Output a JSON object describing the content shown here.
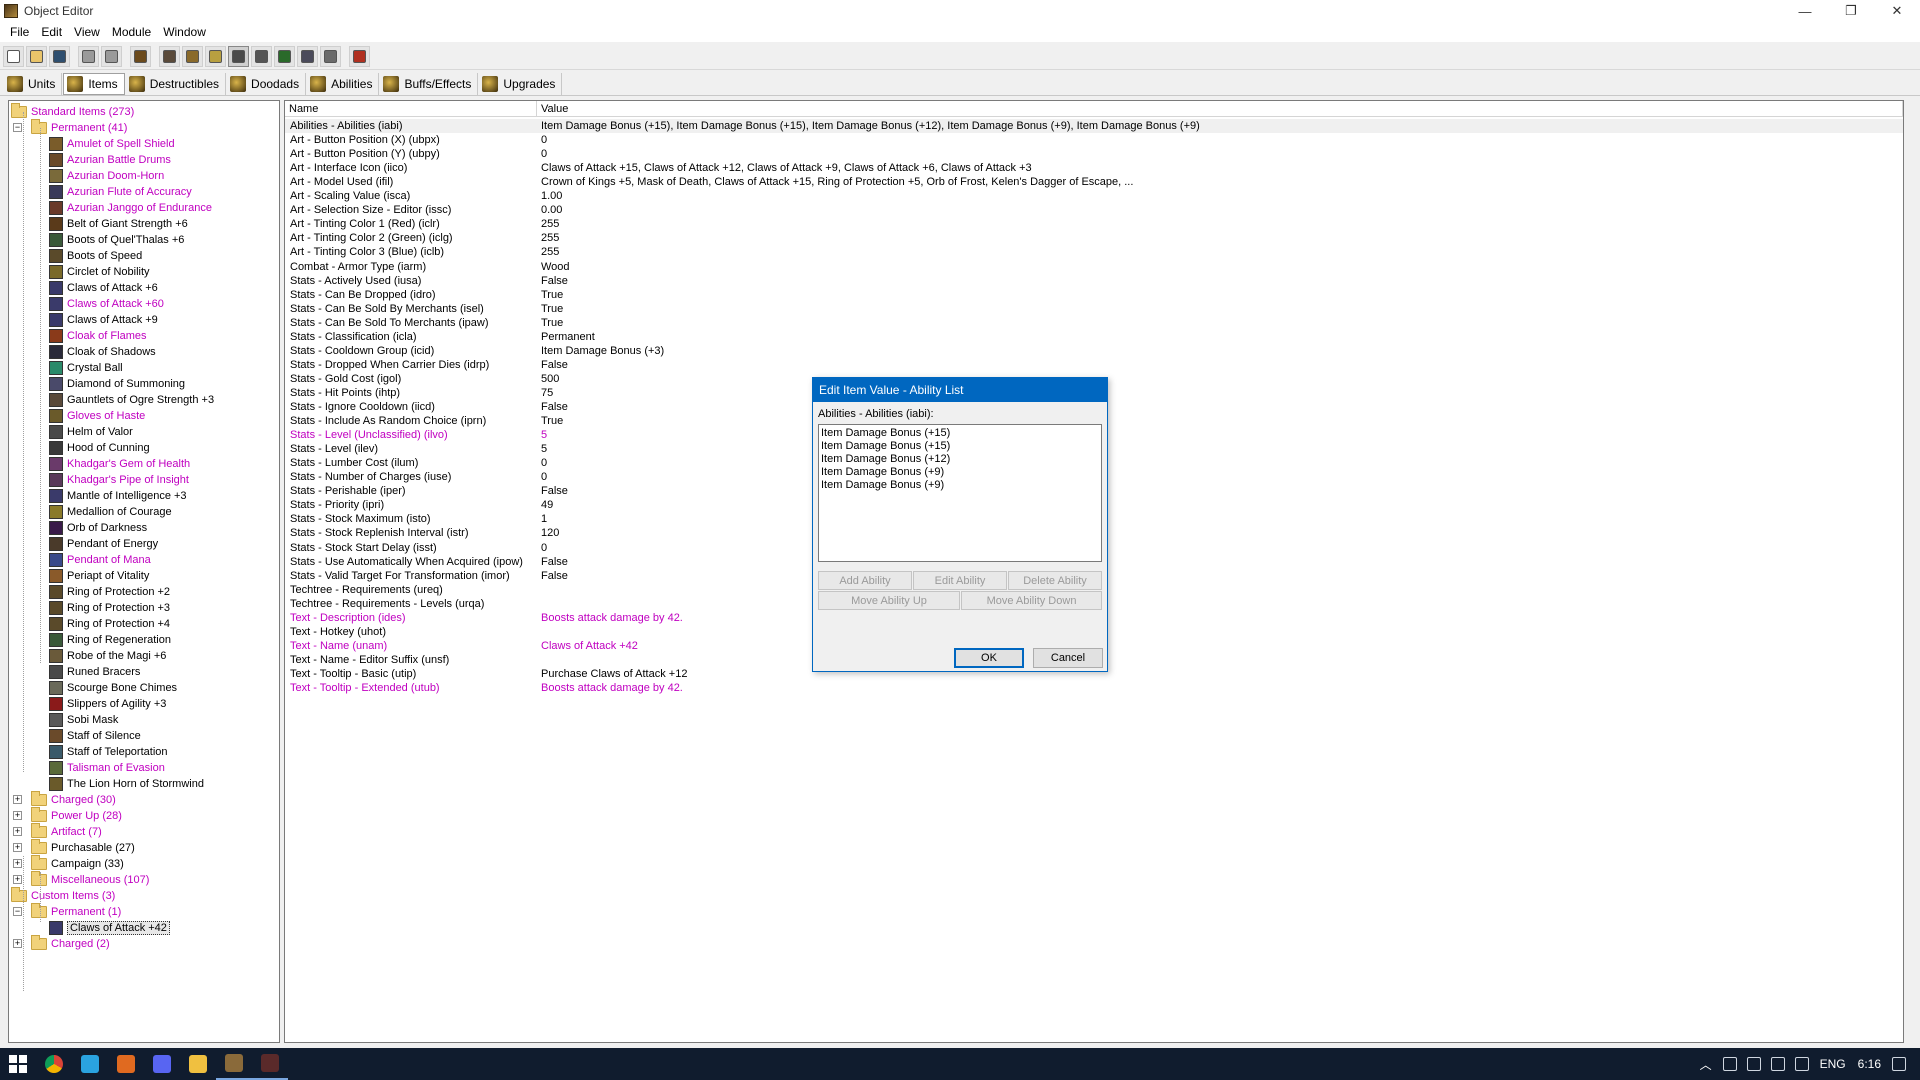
{
  "window": {
    "title": "Object Editor",
    "controls": [
      "—",
      "❐",
      "✕"
    ]
  },
  "menu": [
    "File",
    "Edit",
    "View",
    "Module",
    "Window"
  ],
  "toolbar": {
    "buttons": [
      {
        "icon": "new-file-icon",
        "color": "#ffffff"
      },
      {
        "icon": "open-folder-icon",
        "color": "#e9c46a"
      },
      {
        "icon": "save-disk-icon",
        "color": "#2f4f6f"
      },
      {
        "icon": "copy-icon",
        "color": "#9a9a9a"
      },
      {
        "icon": "paste-icon",
        "color": "#9a9a9a"
      },
      {
        "icon": "unit-editor-icon",
        "color": "#6b4a1c"
      },
      {
        "icon": "terrain-editor-icon",
        "color": "#5a4a3a"
      },
      {
        "icon": "doodad-editor-icon",
        "color": "#8a6a2a"
      },
      {
        "icon": "sound-editor-icon",
        "color": "#b8a040"
      },
      {
        "icon": "object-editor-icon",
        "color": "#4a4a4a"
      },
      {
        "icon": "campaign-editor-icon",
        "color": "#555555"
      },
      {
        "icon": "ai-editor-icon",
        "color": "#2a6a2a"
      },
      {
        "icon": "import-manager-icon",
        "color": "#4a4a5a"
      },
      {
        "icon": "trigger-editor-icon",
        "color": "#6a6a6a"
      },
      {
        "icon": "test-map-icon",
        "color": "#b03020"
      }
    ]
  },
  "tabs": [
    {
      "label": "Units",
      "active": false
    },
    {
      "label": "Items",
      "active": true
    },
    {
      "label": "Destructibles",
      "active": false
    },
    {
      "label": "Doodads",
      "active": false
    },
    {
      "label": "Abilities",
      "active": false
    },
    {
      "label": "Buffs/Effects",
      "active": false
    },
    {
      "label": "Upgrades",
      "active": false
    }
  ],
  "tree": [
    {
      "label": "Standard Items (273)",
      "level": 0,
      "folder": true,
      "expanded": true,
      "pink": true
    },
    {
      "label": "Permanent (41)",
      "level": 1,
      "folder": true,
      "expanded": true,
      "pink": true
    },
    {
      "label": "Amulet of Spell Shield",
      "level": 2,
      "pink": true,
      "color": "#7a5c2a"
    },
    {
      "label": "Azurian Battle Drums",
      "level": 2,
      "pink": true,
      "color": "#6a4a2a"
    },
    {
      "label": "Azurian Doom-Horn",
      "level": 2,
      "pink": true,
      "color": "#7a6a3a"
    },
    {
      "label": "Azurian Flute of Accuracy",
      "level": 2,
      "pink": true,
      "color": "#3a3a5a"
    },
    {
      "label": "Azurian Janggo of Endurance",
      "level": 2,
      "pink": true,
      "color": "#6a3a2a"
    },
    {
      "label": "Belt of Giant Strength +6",
      "level": 2,
      "pink": false,
      "color": "#5a3a1a"
    },
    {
      "label": "Boots of Quel'Thalas +6",
      "level": 2,
      "pink": false,
      "color": "#3a5a3a"
    },
    {
      "label": "Boots of Speed",
      "level": 2,
      "pink": false,
      "color": "#5a4a2a"
    },
    {
      "label": "Circlet of Nobility",
      "level": 2,
      "pink": false,
      "color": "#7a6a2a"
    },
    {
      "label": "Claws of Attack +6",
      "level": 2,
      "pink": false,
      "color": "#3a3a6a"
    },
    {
      "label": "Claws of Attack +60",
      "level": 2,
      "pink": true,
      "color": "#3a3a6a"
    },
    {
      "label": "Claws of Attack +9",
      "level": 2,
      "pink": false,
      "color": "#3a3a6a"
    },
    {
      "label": "Cloak of Flames",
      "level": 2,
      "pink": true,
      "color": "#8a3a1a"
    },
    {
      "label": "Cloak of Shadows",
      "level": 2,
      "pink": false,
      "color": "#2a2a3a"
    },
    {
      "label": "Crystal Ball",
      "level": 2,
      "pink": false,
      "color": "#2a8a6a"
    },
    {
      "label": "Diamond of Summoning",
      "level": 2,
      "pink": false,
      "color": "#4a4a6a"
    },
    {
      "label": "Gauntlets of Ogre Strength +3",
      "level": 2,
      "pink": false,
      "color": "#5a4a3a"
    },
    {
      "label": "Gloves of Haste",
      "level": 2,
      "pink": true,
      "color": "#6a5a2a"
    },
    {
      "label": "Helm of Valor",
      "level": 2,
      "pink": false,
      "color": "#4a4a4a"
    },
    {
      "label": "Hood of Cunning",
      "level": 2,
      "pink": false,
      "color": "#3a3a3a"
    },
    {
      "label": "Khadgar's Gem of Health",
      "level": 2,
      "pink": true,
      "color": "#6a3a6a"
    },
    {
      "label": "Khadgar's Pipe of Insight",
      "level": 2,
      "pink": true,
      "color": "#5a3a5a"
    },
    {
      "label": "Mantle of Intelligence +3",
      "level": 2,
      "pink": false,
      "color": "#3a3a6a"
    },
    {
      "label": "Medallion of Courage",
      "level": 2,
      "pink": false,
      "color": "#8a7a2a"
    },
    {
      "label": "Orb of Darkness",
      "level": 2,
      "pink": false,
      "color": "#3a1a4a"
    },
    {
      "label": "Pendant of Energy",
      "level": 2,
      "pink": false,
      "color": "#4a3a2a"
    },
    {
      "label": "Pendant of Mana",
      "level": 2,
      "pink": true,
      "color": "#3a4a8a"
    },
    {
      "label": "Periapt of Vitality",
      "level": 2,
      "pink": false,
      "color": "#8a5a2a"
    },
    {
      "label": "Ring of Protection +2",
      "level": 2,
      "pink": false,
      "color": "#5a4a2a"
    },
    {
      "label": "Ring of Protection +3",
      "level": 2,
      "pink": false,
      "color": "#5a4a2a"
    },
    {
      "label": "Ring of Protection +4",
      "level": 2,
      "pink": false,
      "color": "#5a4a2a"
    },
    {
      "label": "Ring of Regeneration",
      "level": 2,
      "pink": false,
      "color": "#3a5a3a"
    },
    {
      "label": "Robe of the Magi +6",
      "level": 2,
      "pink": false,
      "color": "#6a5a3a"
    },
    {
      "label": "Runed Bracers",
      "level": 2,
      "pink": false,
      "color": "#4a4a4a"
    },
    {
      "label": "Scourge Bone Chimes",
      "level": 2,
      "pink": false,
      "color": "#6a6a5a"
    },
    {
      "label": "Slippers of Agility +3",
      "level": 2,
      "pink": false,
      "color": "#8a1a1a"
    },
    {
      "label": "Sobi Mask",
      "level": 2,
      "pink": false,
      "color": "#5a5a5a"
    },
    {
      "label": "Staff of Silence",
      "level": 2,
      "pink": false,
      "color": "#6a4a2a"
    },
    {
      "label": "Staff of Teleportation",
      "level": 2,
      "pink": false,
      "color": "#3a5a6a"
    },
    {
      "label": "Talisman of Evasion",
      "level": 2,
      "pink": true,
      "color": "#5a6a3a"
    },
    {
      "label": "The Lion Horn of Stormwind",
      "level": 2,
      "pink": false,
      "color": "#6a5a2a"
    },
    {
      "label": "Charged (30)",
      "level": 1,
      "folder": true,
      "expanded": false,
      "pink": true
    },
    {
      "label": "Power Up (28)",
      "level": 1,
      "folder": true,
      "expanded": false,
      "pink": true
    },
    {
      "label": "Artifact (7)",
      "level": 1,
      "folder": true,
      "expanded": false,
      "pink": true
    },
    {
      "label": "Purchasable (27)",
      "level": 1,
      "folder": true,
      "expanded": false,
      "pink": false
    },
    {
      "label": "Campaign (33)",
      "level": 1,
      "folder": true,
      "expanded": false,
      "pink": false
    },
    {
      "label": "Miscellaneous (107)",
      "level": 1,
      "folder": true,
      "expanded": false,
      "pink": true
    },
    {
      "label": "Custom Items (3)",
      "level": 0,
      "folder": true,
      "expanded": true,
      "pink": true
    },
    {
      "label": "Permanent (1)",
      "level": 1,
      "folder": true,
      "expanded": true,
      "pink": true
    },
    {
      "label": "Claws of Attack +42",
      "level": 2,
      "pink": false,
      "selected": true,
      "color": "#3a3a6a"
    },
    {
      "label": "Charged (2)",
      "level": 1,
      "folder": true,
      "expanded": false,
      "pink": true
    }
  ],
  "grid": {
    "headers": [
      "Name",
      "Value"
    ],
    "rows": [
      {
        "name": "Abilities - Abilities (iabi)",
        "value": "Item Damage Bonus (+15), Item Damage Bonus (+15), Item Damage Bonus (+12), Item Damage Bonus (+9), Item Damage Bonus (+9)",
        "selected": true
      },
      {
        "name": "Art - Button Position (X) (ubpx)",
        "value": "0"
      },
      {
        "name": "Art - Button Position (Y) (ubpy)",
        "value": "0"
      },
      {
        "name": "Art - Interface Icon (iico)",
        "value": "Claws of Attack +15, Claws of Attack +12, Claws of Attack +9, Claws of Attack +6, Claws of Attack +3"
      },
      {
        "name": "Art - Model Used (ifil)",
        "value": "Crown of Kings +5, Mask of Death, Claws of Attack +15, Ring of Protection +5, Orb of Frost, Kelen's Dagger of Escape, ..."
      },
      {
        "name": "Art - Scaling Value (isca)",
        "value": "1.00"
      },
      {
        "name": "Art - Selection Size - Editor (issc)",
        "value": "0.00"
      },
      {
        "name": "Art - Tinting Color 1 (Red) (iclr)",
        "value": "255"
      },
      {
        "name": "Art - Tinting Color 2 (Green) (iclg)",
        "value": "255"
      },
      {
        "name": "Art - Tinting Color 3 (Blue) (iclb)",
        "value": "255"
      },
      {
        "name": "Combat - Armor Type (iarm)",
        "value": "Wood"
      },
      {
        "name": "Stats - Actively Used (iusa)",
        "value": "False"
      },
      {
        "name": "Stats - Can Be Dropped (idro)",
        "value": "True"
      },
      {
        "name": "Stats - Can Be Sold By Merchants (isel)",
        "value": "True"
      },
      {
        "name": "Stats - Can Be Sold To Merchants (ipaw)",
        "value": "True"
      },
      {
        "name": "Stats - Classification (icla)",
        "value": "Permanent"
      },
      {
        "name": "Stats - Cooldown Group (icid)",
        "value": "Item Damage Bonus (+3)"
      },
      {
        "name": "Stats - Dropped When Carrier Dies (idrp)",
        "value": "False"
      },
      {
        "name": "Stats - Gold Cost (igol)",
        "value": "500"
      },
      {
        "name": "Stats - Hit Points (ihtp)",
        "value": "75"
      },
      {
        "name": "Stats - Ignore Cooldown (iicd)",
        "value": "False"
      },
      {
        "name": "Stats - Include As Random Choice (iprn)",
        "value": "True"
      },
      {
        "name": "Stats - Level (Unclassified) (ilvo)",
        "value": "5",
        "pink": true
      },
      {
        "name": "Stats - Level (ilev)",
        "value": "5"
      },
      {
        "name": "Stats - Lumber Cost (ilum)",
        "value": "0"
      },
      {
        "name": "Stats - Number of Charges (iuse)",
        "value": "0"
      },
      {
        "name": "Stats - Perishable (iper)",
        "value": "False"
      },
      {
        "name": "Stats - Priority (ipri)",
        "value": "49"
      },
      {
        "name": "Stats - Stock Maximum (isto)",
        "value": "1"
      },
      {
        "name": "Stats - Stock Replenish Interval (istr)",
        "value": "120"
      },
      {
        "name": "Stats - Stock Start Delay (isst)",
        "value": "0"
      },
      {
        "name": "Stats - Use Automatically When Acquired (ipow)",
        "value": "False"
      },
      {
        "name": "Stats - Valid Target For Transformation (imor)",
        "value": "False"
      },
      {
        "name": "Techtree - Requirements (ureq)",
        "value": ""
      },
      {
        "name": "Techtree - Requirements - Levels (urqa)",
        "value": ""
      },
      {
        "name": "Text - Description (ides)",
        "value": "Boosts attack damage by 42.",
        "pink": true
      },
      {
        "name": "Text - Hotkey (uhot)",
        "value": ""
      },
      {
        "name": "Text - Name (unam)",
        "value": "Claws of Attack +42",
        "pink": true
      },
      {
        "name": "Text - Name - Editor Suffix (unsf)",
        "value": ""
      },
      {
        "name": "Text - Tooltip - Basic (utip)",
        "value": "Purchase Claws of Attack +12"
      },
      {
        "name": "Text - Tooltip - Extended (utub)",
        "value": "Boosts attack damage by 42.",
        "pink": true
      }
    ]
  },
  "dialog": {
    "title": "Edit Item Value - Ability List",
    "label": "Abilities - Abilities (iabi):",
    "items": [
      "Item Damage Bonus (+15)",
      "Item Damage Bonus (+15)",
      "Item Damage Bonus (+12)",
      "Item Damage Bonus (+9)",
      "Item Damage Bonus (+9)"
    ],
    "add": "Add Ability",
    "edit": "Edit Ability",
    "delete": "Delete Ability",
    "move_up": "Move Ability Up",
    "move_down": "Move Ability Down",
    "ok": "OK",
    "cancel": "Cancel"
  },
  "taskbar": {
    "apps": [
      {
        "icon": "windows-start-icon",
        "color": "#ffffff"
      },
      {
        "icon": "chrome-icon",
        "color": "#e0b020"
      },
      {
        "icon": "telegram-icon",
        "color": "#2aa3e0"
      },
      {
        "icon": "git-icon",
        "color": "#e06a20"
      },
      {
        "icon": "discord-icon",
        "color": "#5865f2"
      },
      {
        "icon": "file-explorer-icon",
        "color": "#f0c040"
      },
      {
        "icon": "world-editor-icon",
        "color": "#8a6a3a",
        "running": true
      },
      {
        "icon": "warcraft-icon",
        "color": "#5a2a2a",
        "running": true
      }
    ],
    "language": "ENG",
    "time": "6:16"
  }
}
